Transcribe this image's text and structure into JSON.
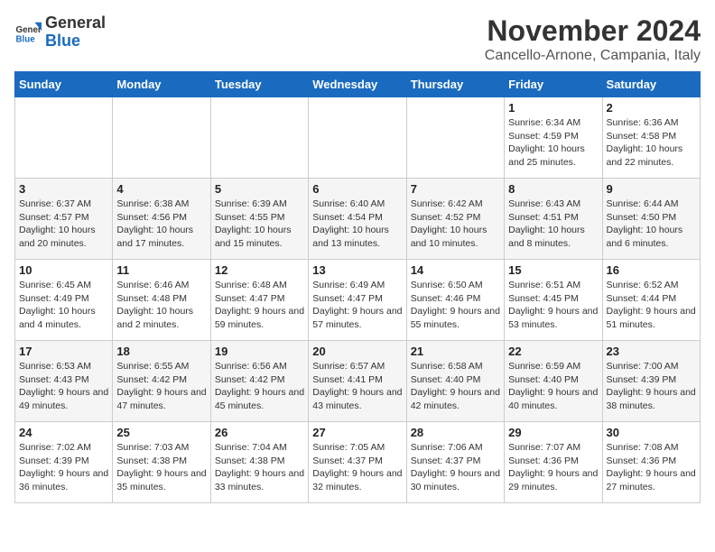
{
  "header": {
    "logo_general": "General",
    "logo_blue": "Blue",
    "month_title": "November 2024",
    "location": "Cancello-Arnone, Campania, Italy"
  },
  "weekdays": [
    "Sunday",
    "Monday",
    "Tuesday",
    "Wednesday",
    "Thursday",
    "Friday",
    "Saturday"
  ],
  "weeks": [
    [
      {
        "day": "",
        "info": ""
      },
      {
        "day": "",
        "info": ""
      },
      {
        "day": "",
        "info": ""
      },
      {
        "day": "",
        "info": ""
      },
      {
        "day": "",
        "info": ""
      },
      {
        "day": "1",
        "info": "Sunrise: 6:34 AM\nSunset: 4:59 PM\nDaylight: 10 hours and 25 minutes."
      },
      {
        "day": "2",
        "info": "Sunrise: 6:36 AM\nSunset: 4:58 PM\nDaylight: 10 hours and 22 minutes."
      }
    ],
    [
      {
        "day": "3",
        "info": "Sunrise: 6:37 AM\nSunset: 4:57 PM\nDaylight: 10 hours and 20 minutes."
      },
      {
        "day": "4",
        "info": "Sunrise: 6:38 AM\nSunset: 4:56 PM\nDaylight: 10 hours and 17 minutes."
      },
      {
        "day": "5",
        "info": "Sunrise: 6:39 AM\nSunset: 4:55 PM\nDaylight: 10 hours and 15 minutes."
      },
      {
        "day": "6",
        "info": "Sunrise: 6:40 AM\nSunset: 4:54 PM\nDaylight: 10 hours and 13 minutes."
      },
      {
        "day": "7",
        "info": "Sunrise: 6:42 AM\nSunset: 4:52 PM\nDaylight: 10 hours and 10 minutes."
      },
      {
        "day": "8",
        "info": "Sunrise: 6:43 AM\nSunset: 4:51 PM\nDaylight: 10 hours and 8 minutes."
      },
      {
        "day": "9",
        "info": "Sunrise: 6:44 AM\nSunset: 4:50 PM\nDaylight: 10 hours and 6 minutes."
      }
    ],
    [
      {
        "day": "10",
        "info": "Sunrise: 6:45 AM\nSunset: 4:49 PM\nDaylight: 10 hours and 4 minutes."
      },
      {
        "day": "11",
        "info": "Sunrise: 6:46 AM\nSunset: 4:48 PM\nDaylight: 10 hours and 2 minutes."
      },
      {
        "day": "12",
        "info": "Sunrise: 6:48 AM\nSunset: 4:47 PM\nDaylight: 9 hours and 59 minutes."
      },
      {
        "day": "13",
        "info": "Sunrise: 6:49 AM\nSunset: 4:47 PM\nDaylight: 9 hours and 57 minutes."
      },
      {
        "day": "14",
        "info": "Sunrise: 6:50 AM\nSunset: 4:46 PM\nDaylight: 9 hours and 55 minutes."
      },
      {
        "day": "15",
        "info": "Sunrise: 6:51 AM\nSunset: 4:45 PM\nDaylight: 9 hours and 53 minutes."
      },
      {
        "day": "16",
        "info": "Sunrise: 6:52 AM\nSunset: 4:44 PM\nDaylight: 9 hours and 51 minutes."
      }
    ],
    [
      {
        "day": "17",
        "info": "Sunrise: 6:53 AM\nSunset: 4:43 PM\nDaylight: 9 hours and 49 minutes."
      },
      {
        "day": "18",
        "info": "Sunrise: 6:55 AM\nSunset: 4:42 PM\nDaylight: 9 hours and 47 minutes."
      },
      {
        "day": "19",
        "info": "Sunrise: 6:56 AM\nSunset: 4:42 PM\nDaylight: 9 hours and 45 minutes."
      },
      {
        "day": "20",
        "info": "Sunrise: 6:57 AM\nSunset: 4:41 PM\nDaylight: 9 hours and 43 minutes."
      },
      {
        "day": "21",
        "info": "Sunrise: 6:58 AM\nSunset: 4:40 PM\nDaylight: 9 hours and 42 minutes."
      },
      {
        "day": "22",
        "info": "Sunrise: 6:59 AM\nSunset: 4:40 PM\nDaylight: 9 hours and 40 minutes."
      },
      {
        "day": "23",
        "info": "Sunrise: 7:00 AM\nSunset: 4:39 PM\nDaylight: 9 hours and 38 minutes."
      }
    ],
    [
      {
        "day": "24",
        "info": "Sunrise: 7:02 AM\nSunset: 4:39 PM\nDaylight: 9 hours and 36 minutes."
      },
      {
        "day": "25",
        "info": "Sunrise: 7:03 AM\nSunset: 4:38 PM\nDaylight: 9 hours and 35 minutes."
      },
      {
        "day": "26",
        "info": "Sunrise: 7:04 AM\nSunset: 4:38 PM\nDaylight: 9 hours and 33 minutes."
      },
      {
        "day": "27",
        "info": "Sunrise: 7:05 AM\nSunset: 4:37 PM\nDaylight: 9 hours and 32 minutes."
      },
      {
        "day": "28",
        "info": "Sunrise: 7:06 AM\nSunset: 4:37 PM\nDaylight: 9 hours and 30 minutes."
      },
      {
        "day": "29",
        "info": "Sunrise: 7:07 AM\nSunset: 4:36 PM\nDaylight: 9 hours and 29 minutes."
      },
      {
        "day": "30",
        "info": "Sunrise: 7:08 AM\nSunset: 4:36 PM\nDaylight: 9 hours and 27 minutes."
      }
    ]
  ]
}
